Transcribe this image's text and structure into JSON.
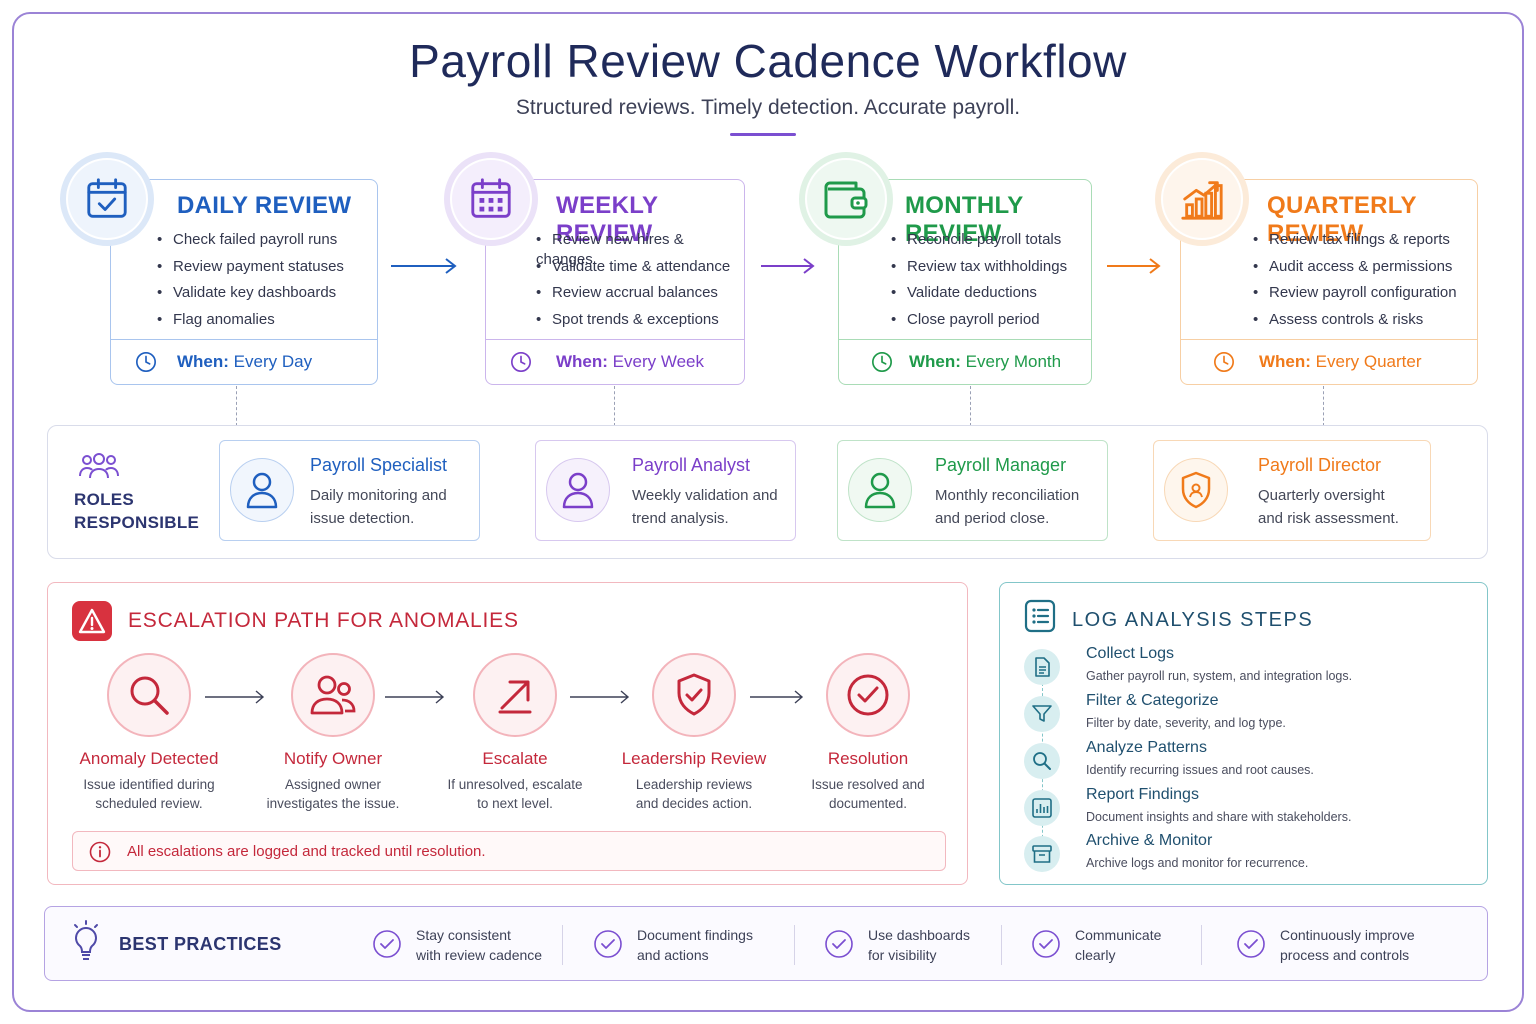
{
  "header": {
    "title": "Payroll Review Cadence Workflow",
    "subtitle": "Structured reviews. Timely detection. Accurate payroll."
  },
  "reviews": [
    {
      "title": "DAILY REVIEW",
      "color": "#1f5fbf",
      "items": [
        "Check failed payroll runs",
        "Review payment statuses",
        "Validate key dashboards",
        "Flag anomalies"
      ],
      "when_label": "When:",
      "when_value": "Every Day",
      "icon": "calendar-check-icon"
    },
    {
      "title": "WEEKLY REVIEW",
      "color": "#7b3fc9",
      "items": [
        "Review new hires & changes",
        "Validate time & attendance",
        "Review accrual balances",
        "Spot trends & exceptions"
      ],
      "when_label": "When:",
      "when_value": "Every Week",
      "icon": "calendar-grid-icon"
    },
    {
      "title": "MONTHLY REVIEW",
      "color": "#1f9a4a",
      "items": [
        "Reconcile payroll totals",
        "Review tax withholdings",
        "Validate deductions",
        "Close payroll period"
      ],
      "when_label": "When:",
      "when_value": "Every Month",
      "icon": "wallet-icon"
    },
    {
      "title": "QUARTERLY REVIEW",
      "color": "#f07a1a",
      "items": [
        "Review tax filings & reports",
        "Audit access & permissions",
        "Review payroll configuration",
        "Assess controls & risks"
      ],
      "when_label": "When:",
      "when_value": "Every Quarter",
      "icon": "bar-chart-trend-icon"
    }
  ],
  "roles": {
    "label_line1": "ROLES",
    "label_line2": "RESPONSIBLE",
    "items": [
      {
        "name": "Payroll Specialist",
        "desc_line1": "Daily monitoring and",
        "desc_line2": "issue detection.",
        "color": "#1f5fbf"
      },
      {
        "name": "Payroll Analyst",
        "desc_line1": "Weekly validation and",
        "desc_line2": "trend analysis.",
        "color": "#7b3fc9"
      },
      {
        "name": "Payroll Manager",
        "desc_line1": "Monthly reconciliation",
        "desc_line2": "and period close.",
        "color": "#1f9a4a"
      },
      {
        "name": "Payroll Director",
        "desc_line1": "Quarterly oversight",
        "desc_line2": "and risk assessment.",
        "color": "#f07a1a"
      }
    ]
  },
  "escalation": {
    "title": "ESCALATION PATH FOR ANOMALIES",
    "steps": [
      {
        "name": "Anomaly Detected",
        "line1": "Issue identified during",
        "line2": "scheduled review.",
        "icon": "magnifier-icon"
      },
      {
        "name": "Notify Owner",
        "line1": "Assigned owner",
        "line2": "investigates the issue.",
        "icon": "users-icon"
      },
      {
        "name": "Escalate",
        "line1": "If unresolved, escalate",
        "line2": "to next level.",
        "icon": "arrow-up-right-icon"
      },
      {
        "name": "Leadership Review",
        "line1": "Leadership reviews",
        "line2": "and decides action.",
        "icon": "shield-check-icon"
      },
      {
        "name": "Resolution",
        "line1": "Issue resolved and",
        "line2": "documented.",
        "icon": "check-circle-icon"
      }
    ],
    "note": "All escalations are logged and tracked until resolution."
  },
  "log_steps": {
    "title": "LOG ANALYSIS STEPS",
    "steps": [
      {
        "name": "Collect Logs",
        "desc": "Gather payroll run, system, and integration logs.",
        "icon": "document-icon"
      },
      {
        "name": "Filter & Categorize",
        "desc": "Filter by date, severity, and log type.",
        "icon": "filter-icon"
      },
      {
        "name": "Analyze Patterns",
        "desc": "Identify recurring issues and root causes.",
        "icon": "search-icon"
      },
      {
        "name": "Report Findings",
        "desc": "Document insights and share with stakeholders.",
        "icon": "report-chart-icon"
      },
      {
        "name": "Archive & Monitor",
        "desc": "Archive logs and monitor for recurrence.",
        "icon": "archive-box-icon"
      }
    ]
  },
  "best_practices": {
    "title": "BEST PRACTICES",
    "items": [
      {
        "line1": "Stay consistent",
        "line2": "with review cadence"
      },
      {
        "line1": "Document findings",
        "line2": "and actions"
      },
      {
        "line1": "Use dashboards",
        "line2": "for visibility"
      },
      {
        "line1": "Communicate",
        "line2": "clearly"
      },
      {
        "line1": "Continuously improve",
        "line2": "process and controls"
      }
    ]
  }
}
